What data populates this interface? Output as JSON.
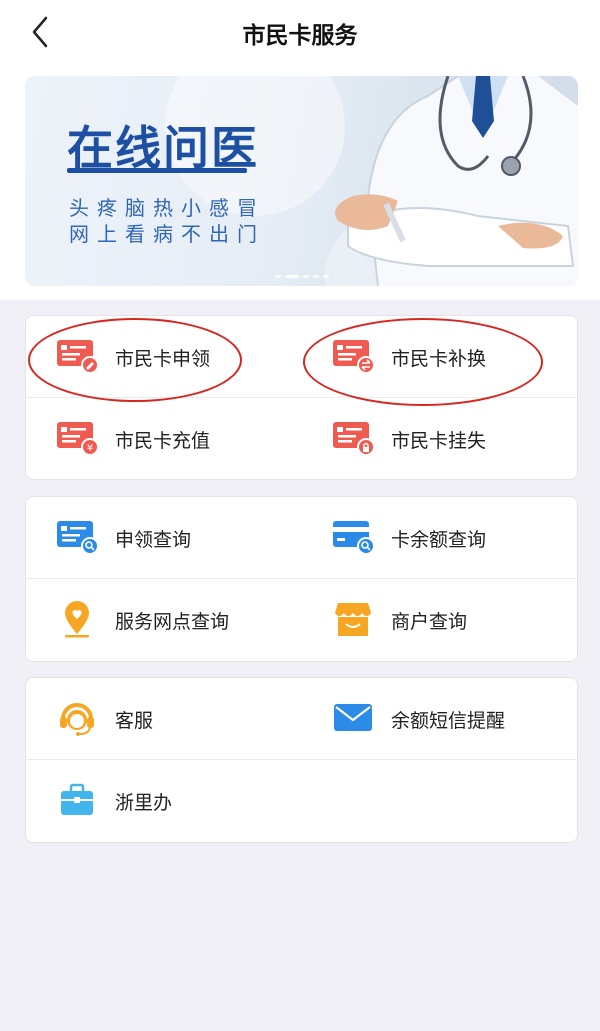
{
  "nav": {
    "title": "市民卡服务"
  },
  "banner": {
    "title": "在线问医",
    "subtitle_line1": "头疼脑热小感冒",
    "subtitle_line2": "网上看病不出门"
  },
  "cards": [
    {
      "rows": [
        [
          {
            "label": "市民卡申领",
            "icon": "card-apply-icon"
          },
          {
            "label": "市民卡补换",
            "icon": "card-replace-icon"
          }
        ],
        [
          {
            "label": "市民卡充值",
            "icon": "card-recharge-icon"
          },
          {
            "label": "市民卡挂失",
            "icon": "card-lost-icon"
          }
        ]
      ]
    },
    {
      "rows": [
        [
          {
            "label": "申领查询",
            "icon": "apply-query-icon"
          },
          {
            "label": "卡余额查询",
            "icon": "balance-query-icon"
          }
        ],
        [
          {
            "label": "服务网点查询",
            "icon": "location-pin-icon"
          },
          {
            "label": "商户查询",
            "icon": "shop-icon"
          }
        ]
      ]
    },
    {
      "rows": [
        [
          {
            "label": "客服",
            "icon": "headset-icon"
          },
          {
            "label": "余额短信提醒",
            "icon": "mail-icon"
          }
        ],
        [
          {
            "label": "浙里办",
            "icon": "briefcase-icon"
          }
        ]
      ]
    }
  ],
  "colors": {
    "red_icon": "#ef5b50",
    "blue_icon": "#2b8be6",
    "orange_icon": "#f6a623",
    "banner_text": "#1d4fa3",
    "annotation_circle": "#d7261e"
  }
}
